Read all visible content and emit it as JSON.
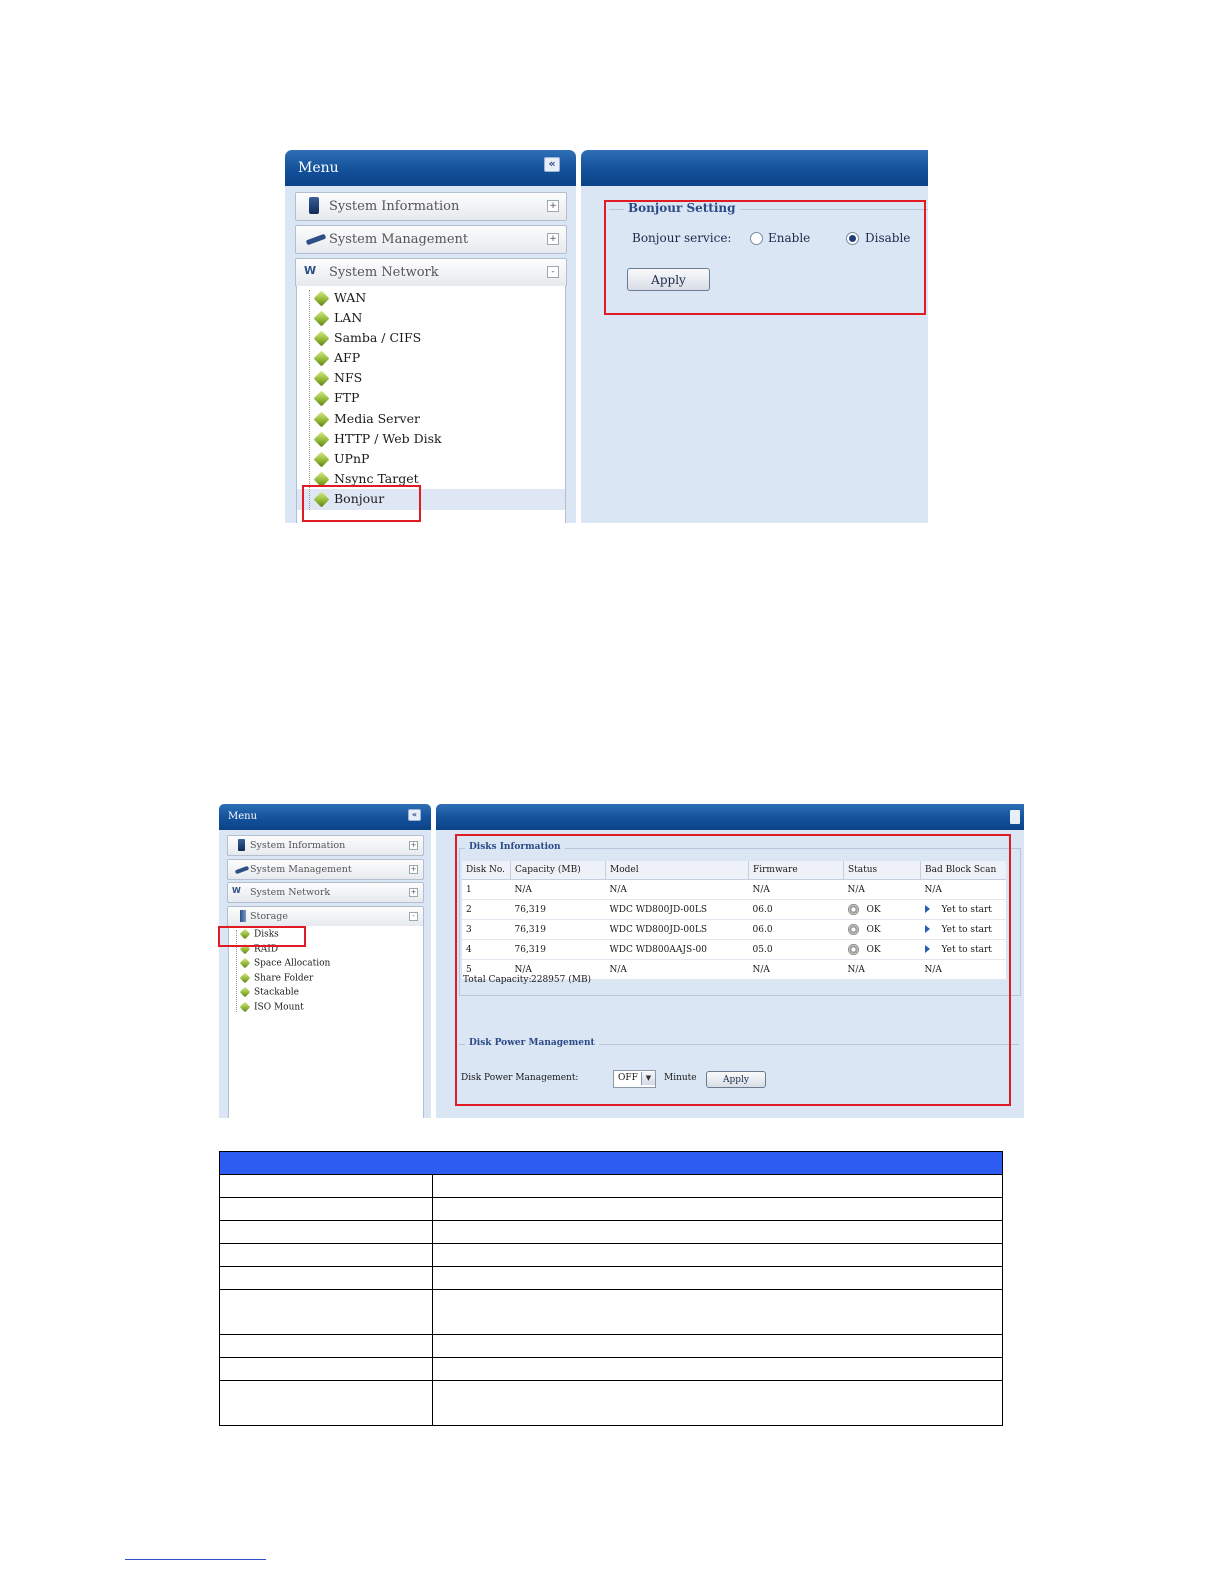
{
  "screenshot1": {
    "menu_title": "Menu",
    "collapse_glyph": "«",
    "categories": [
      {
        "label": "System Information",
        "icon": "monitor-icon",
        "state": "+"
      },
      {
        "label": "System Management",
        "icon": "wrench-icon",
        "state": "+"
      },
      {
        "label": "System Network",
        "icon": "network-icon",
        "state": "-"
      }
    ],
    "items": [
      "WAN",
      "LAN",
      "Samba / CIFS",
      "AFP",
      "NFS",
      "FTP",
      "Media Server",
      "HTTP / Web Disk",
      "UPnP",
      "Nsync Target",
      "Bonjour"
    ],
    "selected_item": "Bonjour",
    "bonjour": {
      "legend": "Bonjour Setting",
      "service_label": "Bonjour service:",
      "enable_label": "Enable",
      "disable_label": "Disable",
      "selected": "Disable",
      "apply_label": "Apply"
    }
  },
  "screenshot2": {
    "menu_title": "Menu",
    "collapse_glyph": "«",
    "categories": [
      {
        "label": "System Information",
        "icon": "monitor-icon",
        "state": "+"
      },
      {
        "label": "System Management",
        "icon": "wrench-icon",
        "state": "+"
      },
      {
        "label": "System Network",
        "icon": "network-icon",
        "state": "+"
      },
      {
        "label": "Storage",
        "icon": "storage-icon",
        "state": "-"
      }
    ],
    "items": [
      "Disks",
      "RAID",
      "Space Allocation",
      "Share Folder",
      "Stackable",
      "ISO Mount"
    ],
    "selected_item": "Disks",
    "disks": {
      "legend": "Disks Information",
      "columns": [
        "Disk No.",
        "Capacity (MB)",
        "Model",
        "Firmware",
        "Status",
        "Bad Block Scan"
      ],
      "rows": [
        {
          "no": "1",
          "cap": "N/A",
          "model": "N/A",
          "fw": "N/A",
          "status": "N/A",
          "scan": "N/A",
          "icons": false
        },
        {
          "no": "2",
          "cap": "76,319",
          "model": "WDC WD800JD-00LS",
          "fw": "06.0",
          "status": "OK",
          "scan": "Yet to start",
          "icons": true
        },
        {
          "no": "3",
          "cap": "76,319",
          "model": "WDC WD800JD-00LS",
          "fw": "06.0",
          "status": "OK",
          "scan": "Yet to start",
          "icons": true
        },
        {
          "no": "4",
          "cap": "76,319",
          "model": "WDC WD800AAJS-00",
          "fw": "05.0",
          "status": "OK",
          "scan": "Yet to start",
          "icons": true
        },
        {
          "no": "5",
          "cap": "N/A",
          "model": "N/A",
          "fw": "N/A",
          "status": "N/A",
          "scan": "N/A",
          "icons": false
        }
      ],
      "total_label": "Total Capacity:",
      "total_value": "228957 (MB)"
    },
    "power": {
      "legend": "Disk Power Management",
      "label": "Disk Power Management:",
      "select_value": "OFF",
      "unit": "Minute",
      "apply_label": "Apply"
    }
  },
  "colors": {
    "header_blue": "#13519a",
    "panel_bg": "#dbe6f5",
    "highlight_red": "#e01b24",
    "doc_table_header": "#2d5cf3"
  }
}
